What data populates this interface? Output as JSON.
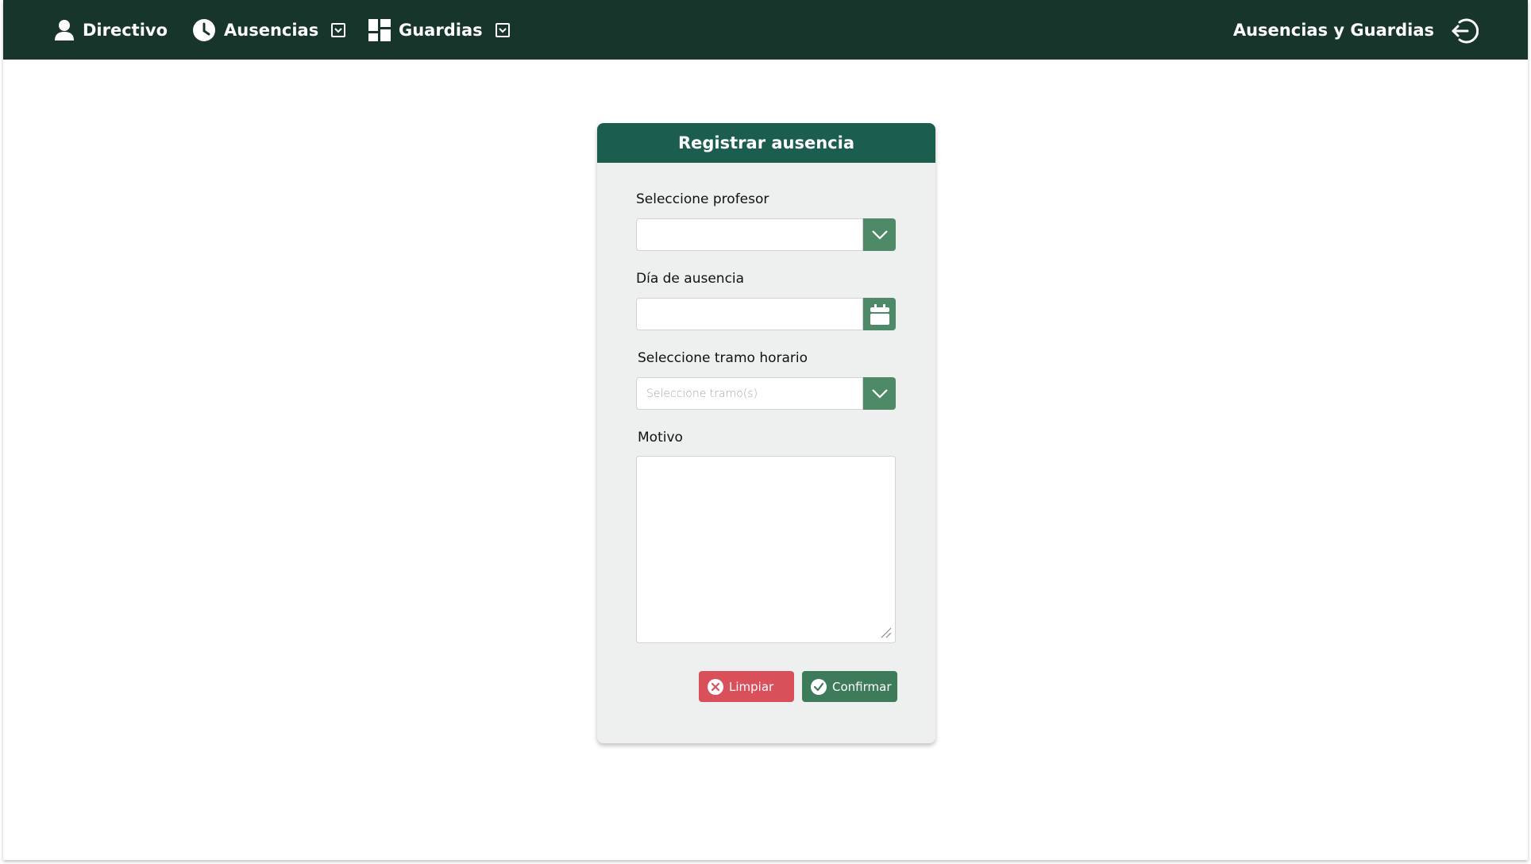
{
  "nav": {
    "directivo_label": "Directivo",
    "ausencias_label": "Ausencias",
    "guardias_label": "Guardias",
    "brand_label": "Ausencias y Guardias"
  },
  "form": {
    "title": "Registrar ausencia",
    "profesor_label": "Seleccione profesor",
    "profesor_value": "",
    "dia_label": "Día de ausencia",
    "dia_value": "",
    "tramo_label": "Seleccione tramo horario",
    "tramo_placeholder": "Seleccione tramo(s)",
    "motivo_label": "Motivo",
    "motivo_value": "",
    "clear_label": "Limpiar",
    "confirm_label": "Confirmar"
  },
  "colors": {
    "navbar": "#17352a",
    "card_header": "#1b5e4f",
    "card_body": "#edf0ee",
    "side_button": "#4e8a68",
    "clear_button": "#d9505a",
    "confirm_button": "#3d7b5b"
  },
  "icons": {
    "directivo": "user-icon",
    "ausencias": "clock-icon",
    "guardias": "dashboard-icon",
    "caret": "caret-down-icon",
    "logout": "logout-icon",
    "dropdown": "chevron-down-icon",
    "calendar": "calendar-icon",
    "clear": "x-circle-icon",
    "confirm": "check-circle-icon"
  }
}
